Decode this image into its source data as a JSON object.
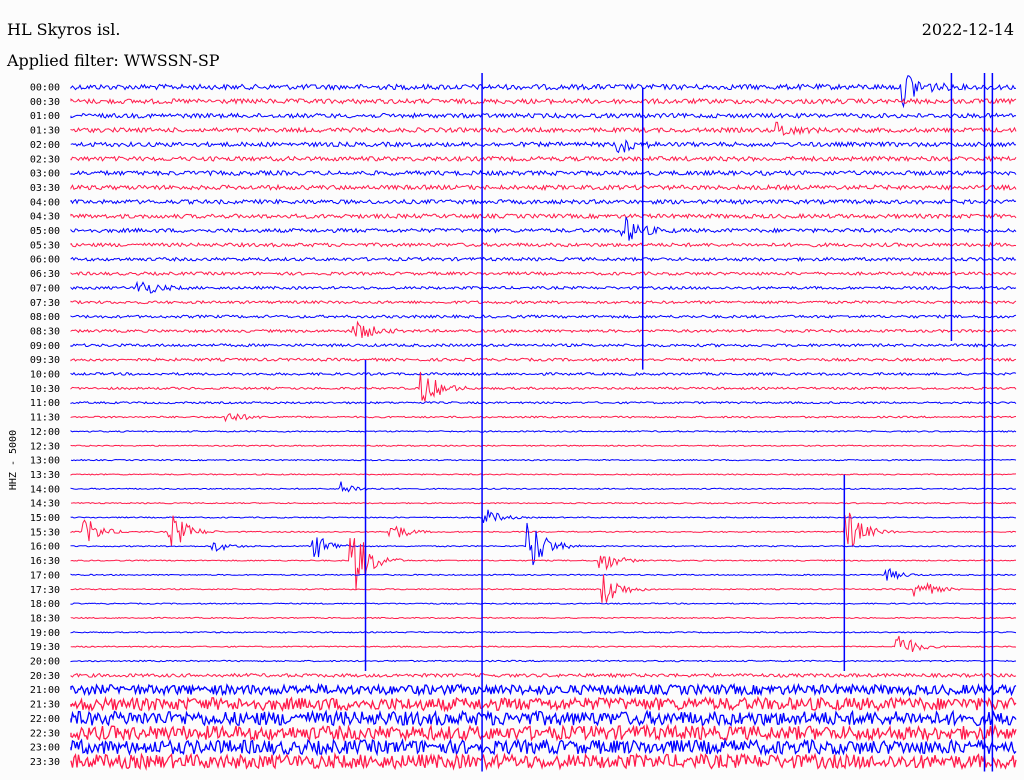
{
  "header": {
    "station": "HL Skyros isl.",
    "filter": "Applied filter: WWSSN-SP",
    "date": "2022-12-14"
  },
  "chart_data": {
    "type": "line",
    "title": "HL Skyros isl.",
    "ylabel": "HHZ - 5000",
    "y_categories": [
      "00:00",
      "00:30",
      "01:00",
      "01:30",
      "02:00",
      "02:30",
      "03:00",
      "03:30",
      "04:00",
      "04:30",
      "05:00",
      "05:30",
      "06:00",
      "06:30",
      "07:00",
      "07:30",
      "08:00",
      "08:30",
      "09:00",
      "09:30",
      "10:00",
      "10:30",
      "11:00",
      "11:30",
      "12:00",
      "12:30",
      "13:00",
      "13:30",
      "14:00",
      "14:30",
      "15:00",
      "15:30",
      "16:00",
      "16:30",
      "17:00",
      "17:30",
      "18:00",
      "18:30",
      "19:00",
      "19:30",
      "20:00",
      "20:30",
      "21:00",
      "21:30",
      "22:00",
      "22:30",
      "23:00",
      "23:30"
    ],
    "trace_colors": [
      "#0000ff",
      "#ff1a4a"
    ],
    "noise_level": [
      0.38,
      0.35,
      0.32,
      0.32,
      0.32,
      0.32,
      0.32,
      0.32,
      0.3,
      0.3,
      0.28,
      0.26,
      0.24,
      0.22,
      0.2,
      0.2,
      0.2,
      0.2,
      0.2,
      0.2,
      0.18,
      0.16,
      0.14,
      0.12,
      0.1,
      0.08,
      0.06,
      0.05,
      0.05,
      0.04,
      0.04,
      0.04,
      0.04,
      0.04,
      0.04,
      0.04,
      0.04,
      0.04,
      0.04,
      0.05,
      0.1,
      0.25,
      0.7,
      0.9,
      1.0,
      1.0,
      1.0,
      1.0
    ],
    "events": [
      {
        "trace": 0,
        "time_min": 26.5,
        "amplitude": 1.2
      },
      {
        "trace": 4,
        "time_min": 17.4,
        "amplitude": 0.6
      },
      {
        "trace": 10,
        "time_min": 17.6,
        "amplitude": 0.9
      },
      {
        "trace": 14,
        "time_min": 2.2,
        "amplitude": 0.6
      },
      {
        "trace": 17,
        "time_min": 9.1,
        "amplitude": 0.7
      },
      {
        "trace": 21,
        "time_min": 11.2,
        "amplitude": 1.2
      },
      {
        "trace": 28,
        "time_min": 8.6,
        "amplitude": 0.5
      },
      {
        "trace": 30,
        "time_min": 13.2,
        "amplitude": 0.6
      },
      {
        "trace": 31,
        "time_min": 0.5,
        "amplitude": 1.0
      },
      {
        "trace": 31,
        "time_min": 3.2,
        "amplitude": 0.5
      },
      {
        "trace": 31,
        "time_min": 3.3,
        "amplitude": 0.8
      },
      {
        "trace": 31,
        "time_min": 10.2,
        "amplitude": 0.7
      },
      {
        "trace": 31,
        "time_min": 24.7,
        "amplitude": 1.5
      },
      {
        "trace": 32,
        "time_min": 7.8,
        "amplitude": 0.9
      },
      {
        "trace": 32,
        "time_min": 14.6,
        "amplitude": 2.0
      },
      {
        "trace": 33,
        "time_min": 9.0,
        "amplitude": 2.5
      },
      {
        "trace": 33,
        "time_min": 16.9,
        "amplitude": 0.8
      },
      {
        "trace": 35,
        "time_min": 17.0,
        "amplitude": 1.2
      },
      {
        "trace": 35,
        "time_min": 26.9,
        "amplitude": 0.8
      },
      {
        "trace": 39,
        "time_min": 26.3,
        "amplitude": 1.0
      }
    ],
    "noise_segments": [
      {
        "trace": 3,
        "time_min": 22.5,
        "amplitude": 0.5
      },
      {
        "trace": 23,
        "time_min": 5.0,
        "amplitude": 0.4
      },
      {
        "trace": 32,
        "time_min": 4.6,
        "amplitude": 0.4
      },
      {
        "trace": 34,
        "time_min": 26.0,
        "amplitude": 0.4
      }
    ],
    "vertical_spikes": [
      {
        "time_min": 13.05,
        "trace_from": 0,
        "trace_to": 47
      },
      {
        "time_min": 18.15,
        "trace_from": 1,
        "trace_to": 19
      },
      {
        "time_min": 29.0,
        "trace_from": 0,
        "trace_to": 47
      },
      {
        "time_min": 29.25,
        "trace_from": 0,
        "trace_to": 47
      },
      {
        "time_min": 27.95,
        "trace_from": 0,
        "trace_to": 17
      },
      {
        "time_min": 24.55,
        "trace_from": 28,
        "trace_to": 40
      },
      {
        "time_min": 9.35,
        "trace_from": 20,
        "trace_to": 40
      }
    ],
    "x_range_min": [
      0,
      30
    ],
    "grid": false
  }
}
